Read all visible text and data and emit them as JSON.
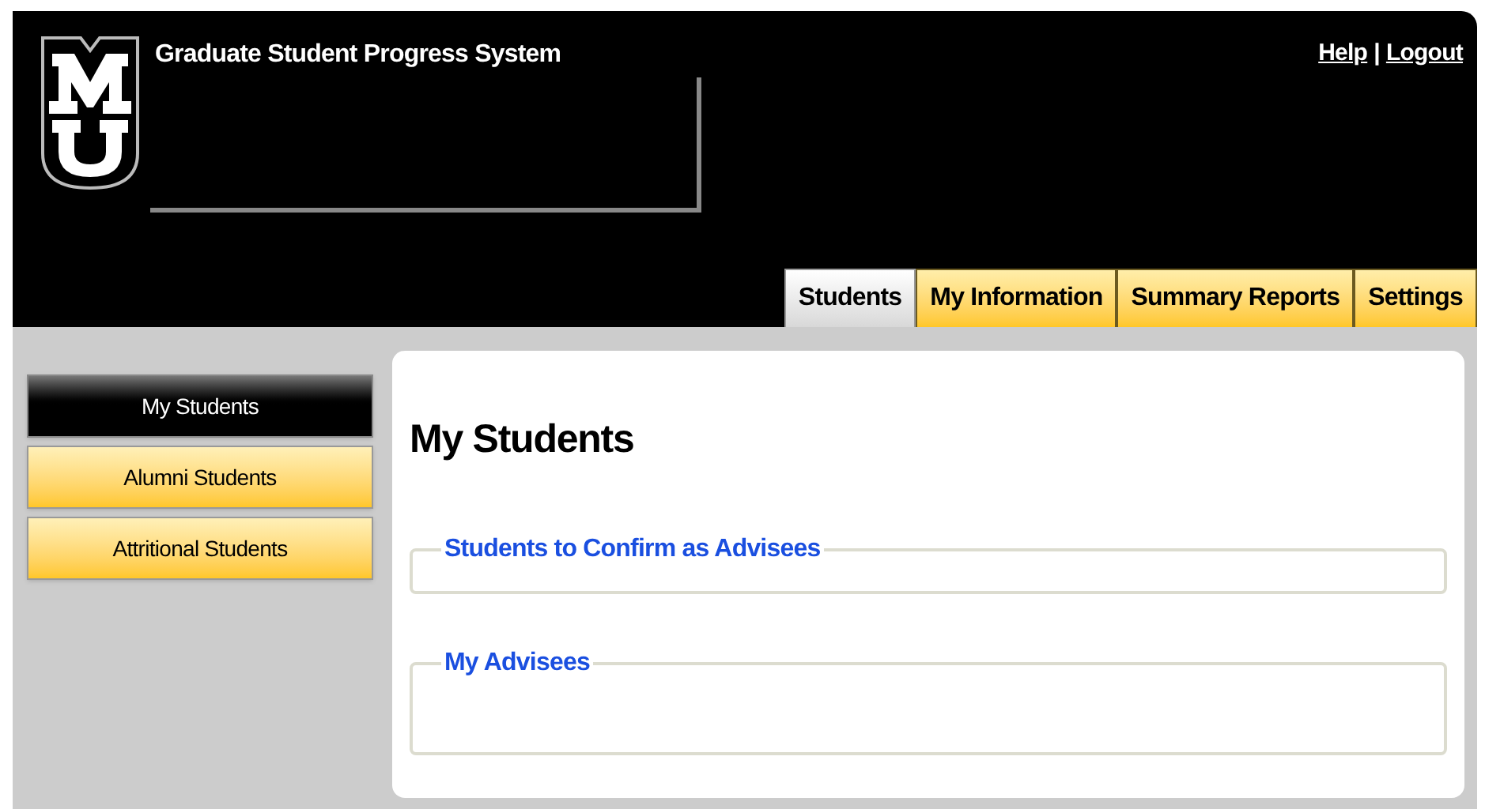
{
  "header": {
    "title": "Graduate Student Progress System",
    "links": [
      {
        "label": "Help"
      },
      {
        "label": "Logout"
      }
    ],
    "separator": "|"
  },
  "tabs": [
    {
      "label": "Students",
      "selected": true
    },
    {
      "label": "My Information",
      "selected": false
    },
    {
      "label": "Summary Reports",
      "selected": false
    },
    {
      "label": "Settings",
      "selected": false
    }
  ],
  "sidebar": {
    "items": [
      {
        "label": "My Students",
        "selected": true
      },
      {
        "label": "Alumni Students",
        "selected": false
      },
      {
        "label": "Attritional Students",
        "selected": false
      }
    ]
  },
  "main": {
    "heading": "My Students",
    "sections": [
      {
        "title": "Students to Confirm as Advisees"
      },
      {
        "title": "My Advisees"
      }
    ]
  }
}
